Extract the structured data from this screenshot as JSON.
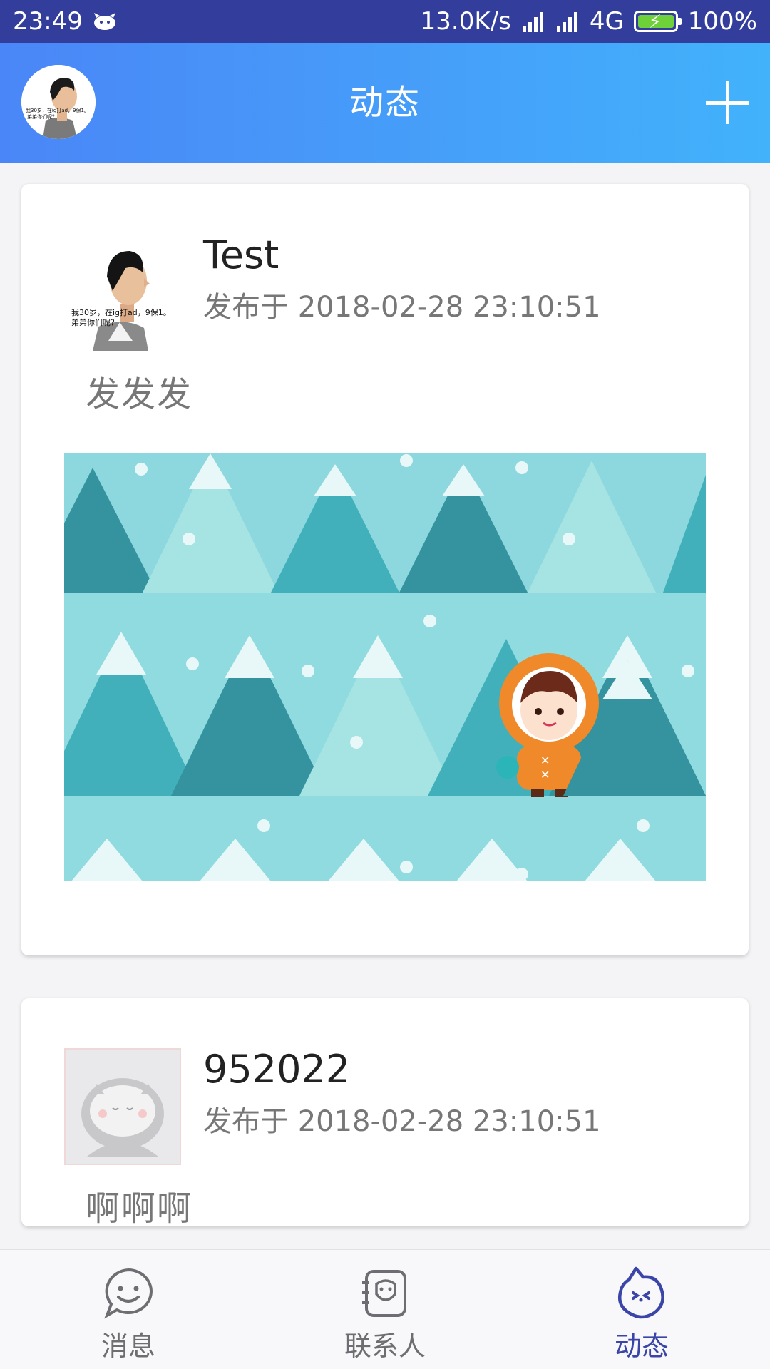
{
  "status_bar": {
    "time": "23:49",
    "speed": "13.0K/s",
    "network": "4G",
    "battery": "100%",
    "icons": [
      "app-notification-icon",
      "signal-icon",
      "signal-icon",
      "battery-charging-icon"
    ]
  },
  "header": {
    "title": "动态",
    "avatar_caption": "我30岁，在ig打ad，9保1。弟弟你们呢？",
    "add_icon": "plus-icon"
  },
  "posts": [
    {
      "name": "Test",
      "time": "发布于 2018-02-28 23:10:51",
      "text": "发发发",
      "avatar_caption": "我30岁，在ig打ad，9保1。弟弟你们呢？"
    },
    {
      "name": "952022",
      "time": "发布于 2018-02-28 23:10:51",
      "text": "啊啊啊"
    }
  ],
  "bottom_nav": {
    "items": [
      {
        "label": "消息",
        "icon": "chat-smile-icon",
        "active": false
      },
      {
        "label": "联系人",
        "icon": "contacts-icon",
        "active": false
      },
      {
        "label": "动态",
        "icon": "moments-icon",
        "active": true
      }
    ]
  },
  "colors": {
    "status_bar": "#333d9c",
    "header_start": "#4a86f7",
    "header_end": "#42b2fb",
    "nav_active": "#3b45a8",
    "nav_inactive": "#6e6e72"
  }
}
